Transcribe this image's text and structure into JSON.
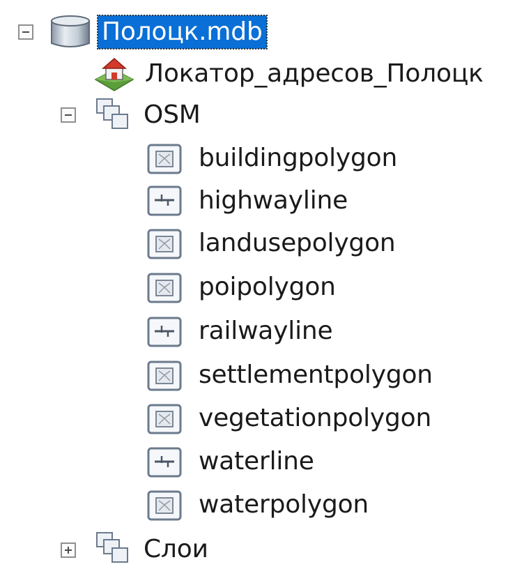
{
  "tree": {
    "root": {
      "label": "Полоцк.mdb",
      "expanded": true,
      "icon": "database-icon"
    },
    "locator": {
      "label": "Локатор_адресов_Полоцк",
      "icon": "address-locator-icon"
    },
    "osm": {
      "label": "OSM",
      "expanded": true,
      "icon": "feature-dataset-icon",
      "children": [
        {
          "label": "buildingpolygon",
          "icon": "polygon-feature-class-icon"
        },
        {
          "label": "highwayline",
          "icon": "line-feature-class-icon"
        },
        {
          "label": "landusepolygon",
          "icon": "polygon-feature-class-icon"
        },
        {
          "label": "poipolygon",
          "icon": "polygon-feature-class-icon"
        },
        {
          "label": "railwayline",
          "icon": "line-feature-class-icon"
        },
        {
          "label": "settlementpolygon",
          "icon": "polygon-feature-class-icon"
        },
        {
          "label": "vegetationpolygon",
          "icon": "polygon-feature-class-icon"
        },
        {
          "label": "waterline",
          "icon": "line-feature-class-icon"
        },
        {
          "label": "waterpolygon",
          "icon": "polygon-feature-class-icon"
        }
      ]
    },
    "layers": {
      "label": "Слои",
      "expanded": false,
      "icon": "feature-dataset-icon"
    }
  },
  "colors": {
    "selection": "#0a6fd6",
    "text": "#1a1a1a"
  }
}
